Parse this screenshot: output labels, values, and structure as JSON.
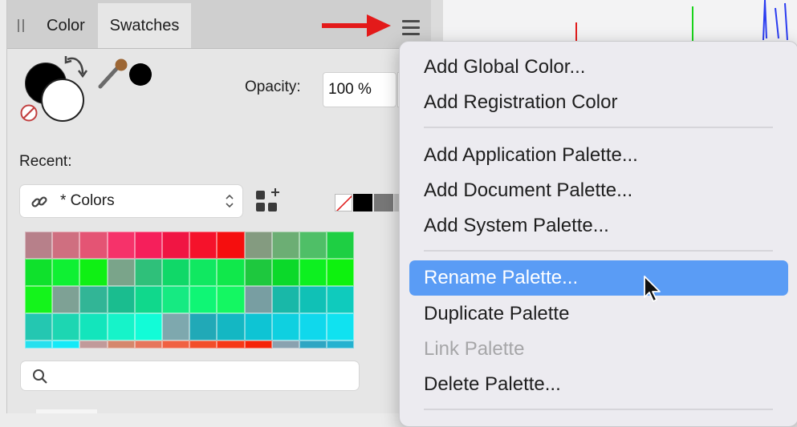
{
  "panel": {
    "tabs": [
      {
        "label": "Color"
      },
      {
        "label": "Swatches"
      }
    ],
    "opacity": {
      "label": "Opacity:",
      "value": "100 %"
    },
    "recent": {
      "label": "Recent:"
    },
    "palette_select": {
      "value": "* Colors"
    },
    "search": {
      "placeholder": ""
    },
    "colors": {
      "fill": "#000000",
      "stroke": "#ffffff"
    }
  },
  "menu": {
    "items": [
      {
        "label": "Add Global Color...",
        "state": "normal"
      },
      {
        "label": "Add Registration Color",
        "state": "normal"
      },
      {
        "label": "Add Application Palette...",
        "state": "normal"
      },
      {
        "label": "Add Document Palette...",
        "state": "normal"
      },
      {
        "label": "Add System Palette...",
        "state": "normal"
      },
      {
        "label": "Rename Palette...",
        "state": "highlighted"
      },
      {
        "label": "Duplicate Palette",
        "state": "normal"
      },
      {
        "label": "Link Palette",
        "state": "disabled"
      },
      {
        "label": "Delete Palette...",
        "state": "normal"
      }
    ],
    "highlight_color": "#5a9cf5"
  },
  "annotation": {
    "arrow_color": "#e31a1a"
  },
  "swatches": {
    "rows": [
      [
        "#b7808a",
        "#cf6f80",
        "#e45474",
        "#f6326a",
        "#f51f5b",
        "#f01543",
        "#f5122b",
        "#f50e0e",
        "#849b80",
        "#6cae74",
        "#4fbf67",
        "#1ecf43"
      ],
      [
        "#0fe12c",
        "#0ff033",
        "#0ff014",
        "#7aa48a",
        "#2fc07a",
        "#10d868",
        "#10e861",
        "#10e84b",
        "#1ec83e",
        "#0bd92a",
        "#0df020",
        "#0df20e"
      ],
      [
        "#14f41b",
        "#7ea195",
        "#32b596",
        "#1abd8f",
        "#10d88c",
        "#16ea82",
        "#0ff675",
        "#14f762",
        "#789ea2",
        "#19b8a8",
        "#10c1b6",
        "#0fcbbd"
      ],
      [
        "#24c7b1",
        "#1dd6b2",
        "#13e5bc",
        "#16f3c9",
        "#12fcd7",
        "#7ea8ae",
        "#21a9b7",
        "#14b7c3",
        "#0ec4d4",
        "#0fd0e0",
        "#10d8ec",
        "#10e2f0"
      ],
      [
        "#26e0ee",
        "#14e9f7",
        "#c19a9a",
        "#d5876c",
        "#e6765c",
        "#f06142",
        "#f24e2a",
        "#f63817",
        "#f52308",
        "#8aa2b0",
        "#2ea6c3",
        "#24b2d0"
      ]
    ]
  }
}
